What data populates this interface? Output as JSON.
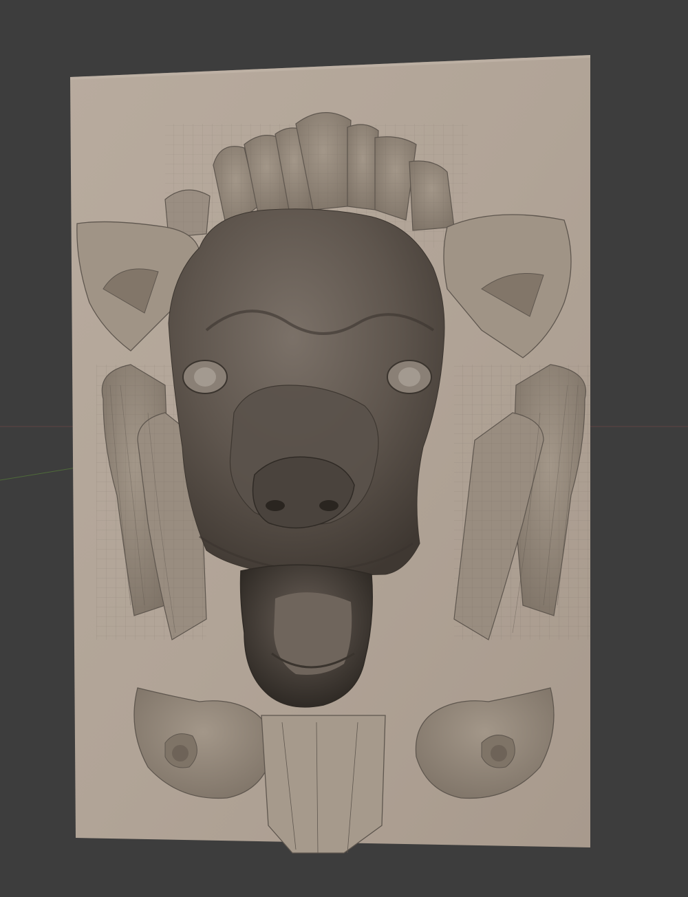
{
  "viewport": {
    "background_color": "#3d3d3d",
    "axis_x_color": "#7a4a4a",
    "axis_y_color": "#4f6b3a"
  },
  "model": {
    "subject": "lion-head-relief",
    "panel_color": "#b3a699",
    "relief_color": "#8f857a",
    "face_color": "#5a524b",
    "wireframe_color": "#5e564e"
  }
}
